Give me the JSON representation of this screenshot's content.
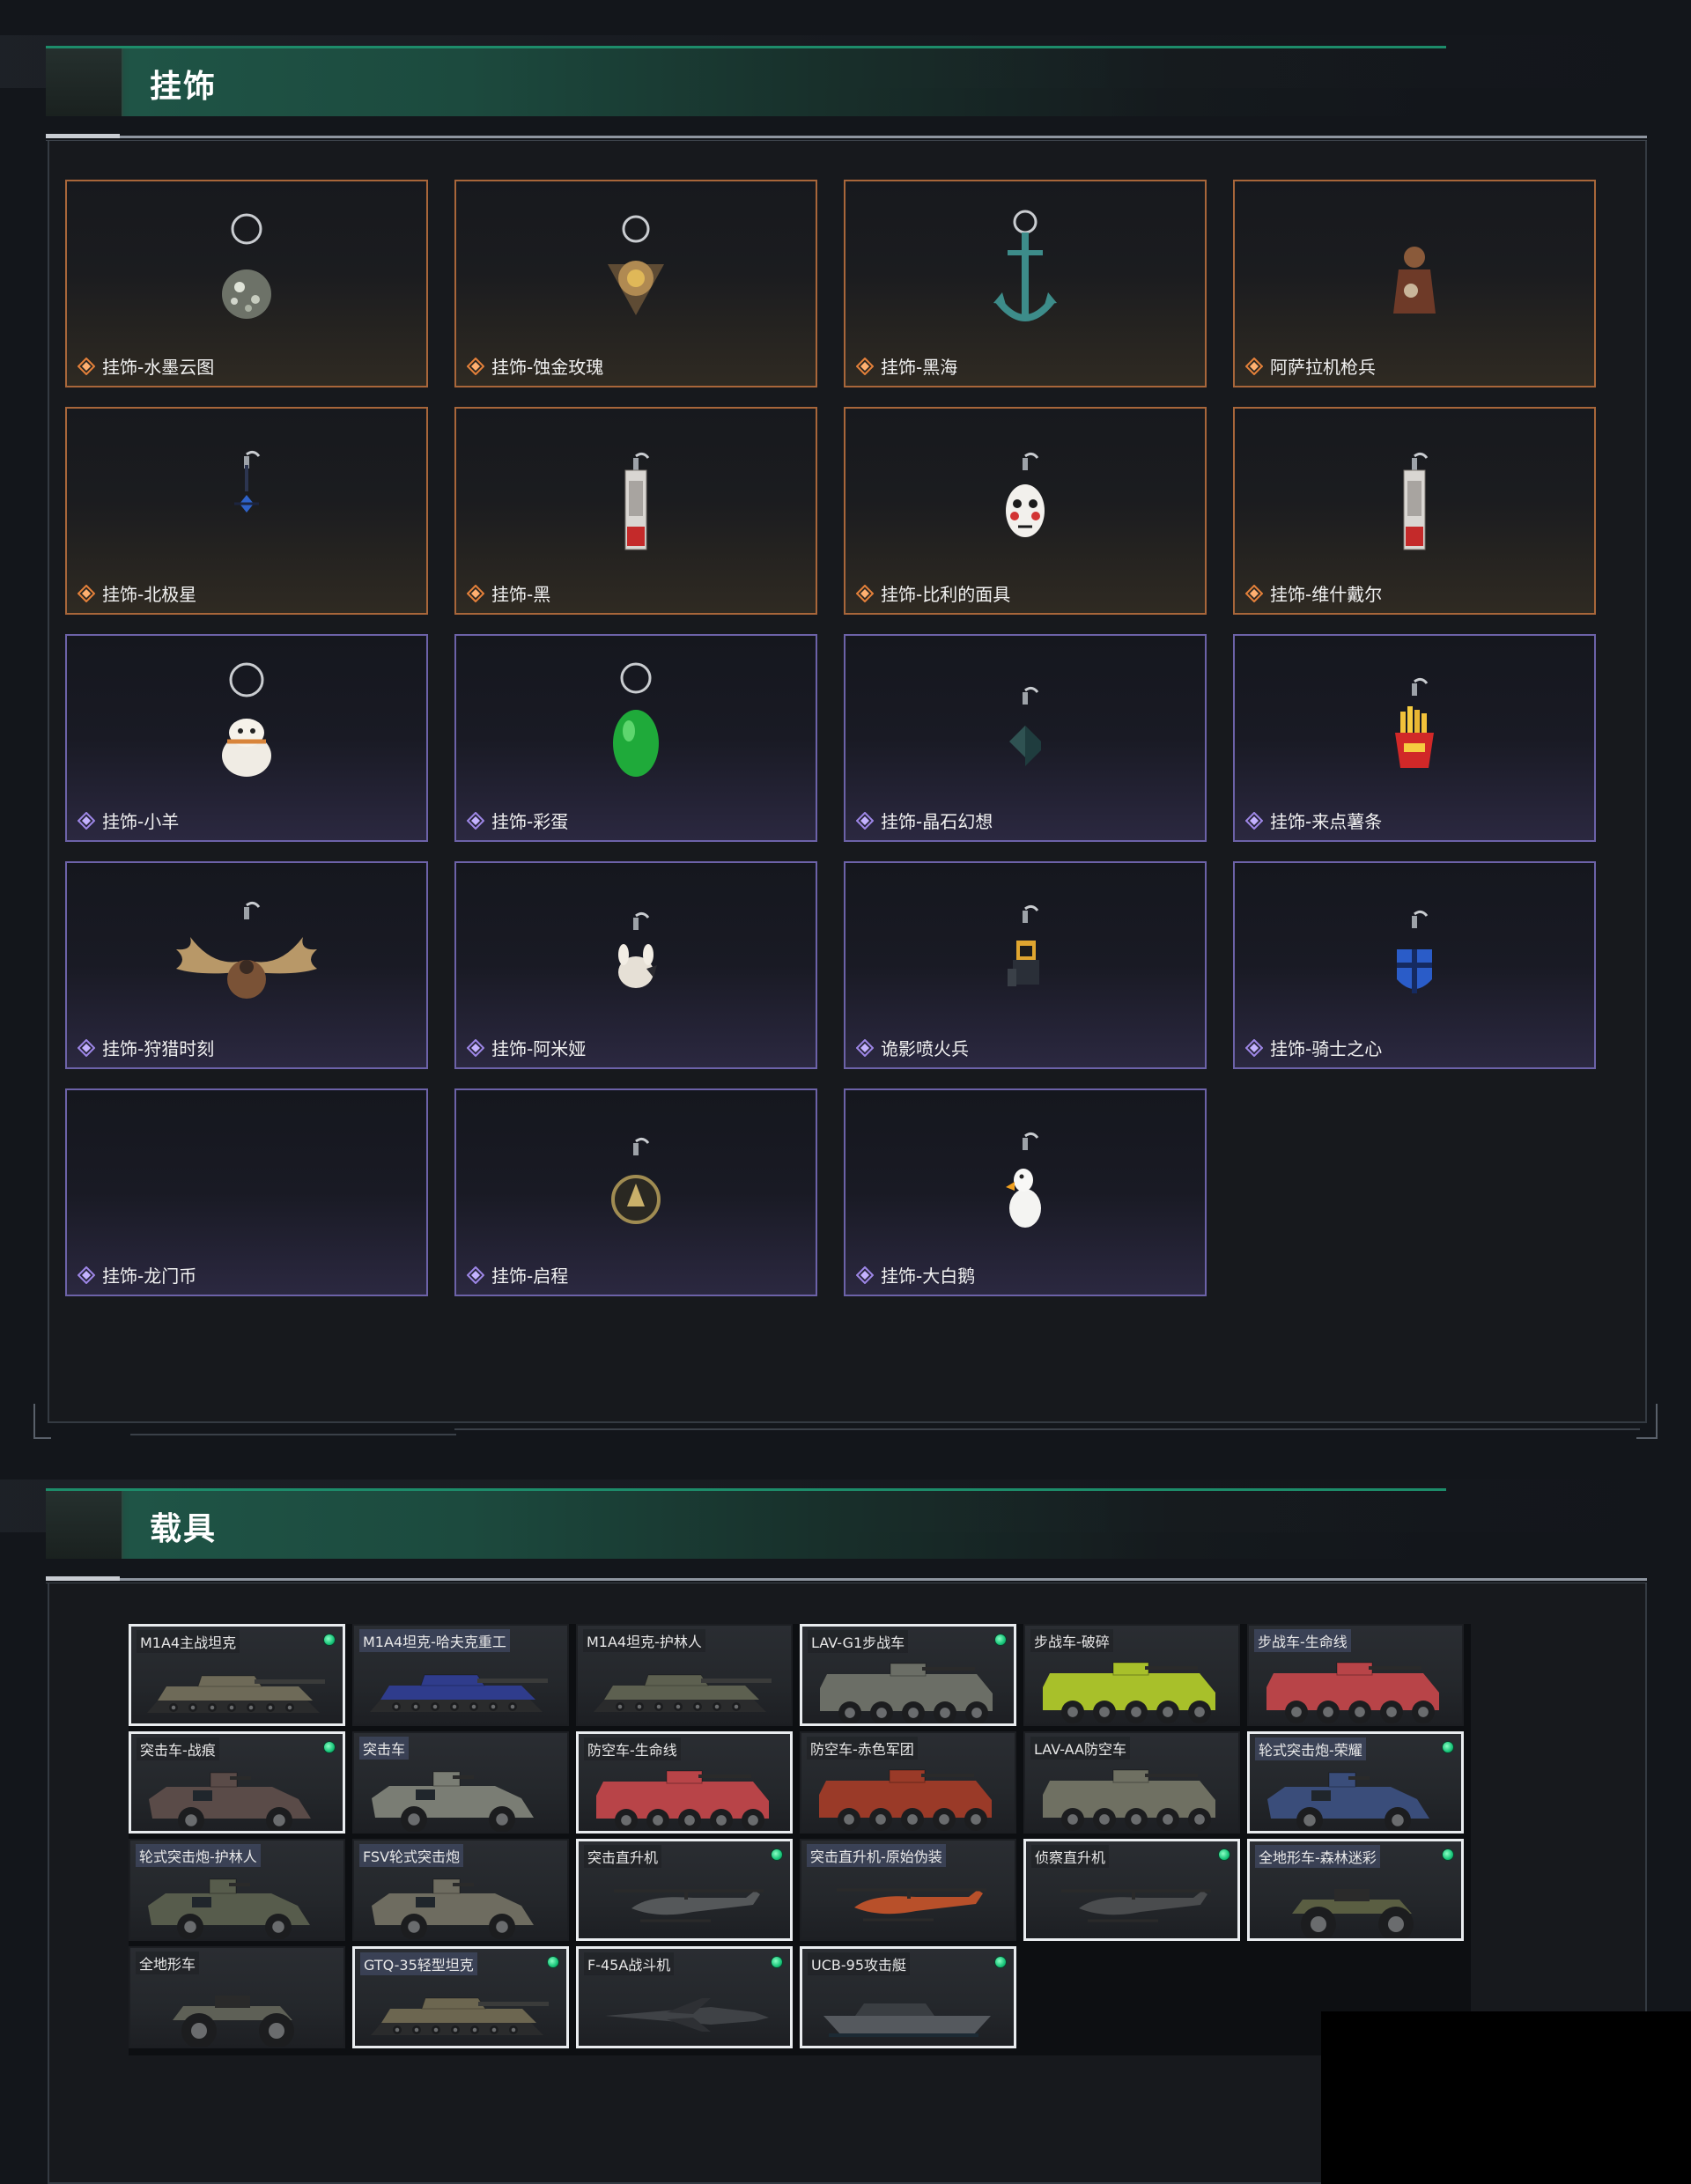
{
  "colors": {
    "accent_green": "#1d8c6a",
    "card_border_gold": "#b26b3a",
    "card_border_purple": "#6c62a8",
    "badge_green": "#17c479"
  },
  "sections": {
    "pendants_title": "挂饰",
    "vehicles_title": "载具"
  },
  "pendants": [
    {
      "name": "挂饰-水墨云图",
      "rarity": "gold",
      "icon": "ornament-ball-icon"
    },
    {
      "name": "挂饰-蚀金玫瑰",
      "rarity": "gold",
      "icon": "rose-emblem-icon"
    },
    {
      "name": "挂饰-黑海",
      "rarity": "gold",
      "icon": "anchor-icon"
    },
    {
      "name": "阿萨拉机枪兵",
      "rarity": "gold",
      "icon": "gunner-figure-icon"
    },
    {
      "name": "挂饰-北极星",
      "rarity": "gold",
      "icon": "star-charm-icon"
    },
    {
      "name": "挂饰-黑",
      "rarity": "gold",
      "icon": "card-tag-icon"
    },
    {
      "name": "挂饰-比利的面具",
      "rarity": "gold",
      "icon": "mask-icon"
    },
    {
      "name": "挂饰-维什戴尔",
      "rarity": "gold",
      "icon": "card-tag-icon"
    },
    {
      "name": "挂饰-小羊",
      "rarity": "purple",
      "icon": "sheep-icon"
    },
    {
      "name": "挂饰-彩蛋",
      "rarity": "purple",
      "icon": "egg-icon"
    },
    {
      "name": "挂饰-晶石幻想",
      "rarity": "purple",
      "icon": "crystal-cube-icon"
    },
    {
      "name": "挂饰-来点薯条",
      "rarity": "purple",
      "icon": "fries-icon"
    },
    {
      "name": "挂饰-狩猎时刻",
      "rarity": "purple",
      "icon": "moose-antler-icon"
    },
    {
      "name": "挂饰-阿米娅",
      "rarity": "purple",
      "icon": "bunny-icon"
    },
    {
      "name": "诡影喷火兵",
      "rarity": "purple",
      "icon": "flamer-figure-icon"
    },
    {
      "name": "挂饰-骑士之心",
      "rarity": "purple",
      "icon": "knight-shield-icon"
    },
    {
      "name": "挂饰-龙门币",
      "rarity": "purple",
      "icon": ""
    },
    {
      "name": "挂饰-启程",
      "rarity": "purple",
      "icon": "medal-icon"
    },
    {
      "name": "挂饰-大白鹅",
      "rarity": "purple",
      "icon": "goose-icon"
    }
  ],
  "vehicles": [
    {
      "name": "M1A4主战坦克",
      "selected": true,
      "owned": true,
      "kind": "tank",
      "tint": "#6e6a58"
    },
    {
      "name": "M1A4坦克-哈夫克重工",
      "selected": false,
      "owned": false,
      "kind": "tank",
      "tint": "#2f3c8c"
    },
    {
      "name": "M1A4坦克-护林人",
      "selected": false,
      "owned": false,
      "kind": "tank",
      "tint": "#5d6050"
    },
    {
      "name": "LAV-G1步战车",
      "selected": true,
      "owned": true,
      "kind": "ifv",
      "tint": "#6b6e66"
    },
    {
      "name": "步战车-破碎",
      "selected": false,
      "owned": false,
      "kind": "ifv",
      "tint": "#a8c02a"
    },
    {
      "name": "步战车-生命线",
      "selected": false,
      "owned": false,
      "kind": "ifv",
      "tint": "#b84448"
    },
    {
      "name": "突击车-战痕",
      "selected": true,
      "owned": true,
      "kind": "armored",
      "tint": "#5a4b48"
    },
    {
      "name": "突击车",
      "selected": false,
      "owned": false,
      "kind": "armored",
      "tint": "#7a7d74"
    },
    {
      "name": "防空车-生命线",
      "selected": true,
      "owned": false,
      "kind": "ifv",
      "tint": "#b84448"
    },
    {
      "name": "防空车-赤色军团",
      "selected": false,
      "owned": false,
      "kind": "ifv",
      "tint": "#9a3a28"
    },
    {
      "name": "LAV-AA防空车",
      "selected": false,
      "owned": false,
      "kind": "ifv",
      "tint": "#6f7062"
    },
    {
      "name": "轮式突击炮-荣耀",
      "selected": true,
      "owned": true,
      "kind": "armored",
      "tint": "#3a4d7a"
    },
    {
      "name": "轮式突击炮-护林人",
      "selected": false,
      "owned": false,
      "kind": "armored",
      "tint": "#575c4c"
    },
    {
      "name": "FSV轮式突击炮",
      "selected": false,
      "owned": false,
      "kind": "armored",
      "tint": "#6e6c60"
    },
    {
      "name": "突击直升机",
      "selected": true,
      "owned": true,
      "kind": "heli",
      "tint": "#55585a"
    },
    {
      "name": "突击直升机-原始伪装",
      "selected": false,
      "owned": false,
      "kind": "heli",
      "tint": "#b8502a"
    },
    {
      "name": "侦察直升机",
      "selected": true,
      "owned": true,
      "kind": "heli",
      "tint": "#4a4c4e"
    },
    {
      "name": "全地形车-森林迷彩",
      "selected": true,
      "owned": true,
      "kind": "atv",
      "tint": "#5a5e42"
    },
    {
      "name": "全地形车",
      "selected": false,
      "owned": false,
      "kind": "atv",
      "tint": "#5e6056"
    },
    {
      "name": "GTQ-35轻型坦克",
      "selected": true,
      "owned": true,
      "kind": "tank",
      "tint": "#6c6650"
    },
    {
      "name": "F-45A战斗机",
      "selected": true,
      "owned": true,
      "kind": "jet",
      "tint": "#3f4246"
    },
    {
      "name": "UCB-95攻击艇",
      "selected": true,
      "owned": true,
      "kind": "boat",
      "tint": "#55595e"
    }
  ]
}
